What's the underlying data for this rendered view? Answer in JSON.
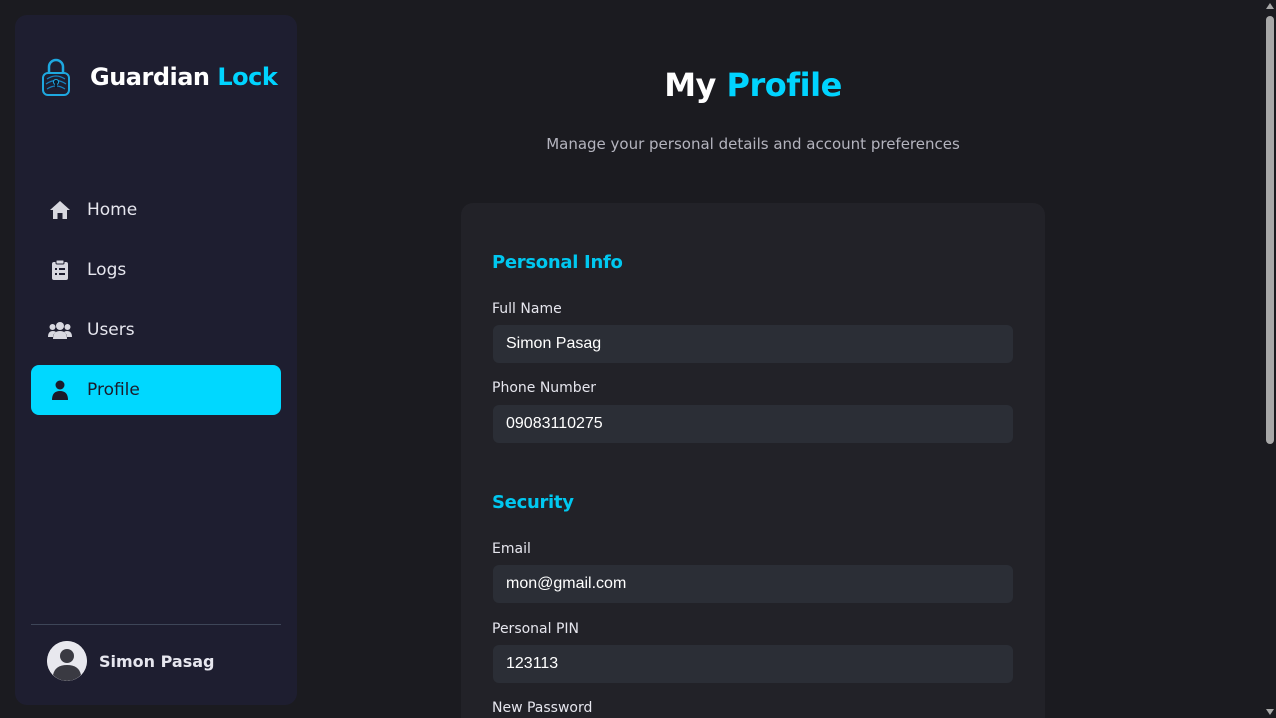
{
  "brand": {
    "name_part1": "Guardian",
    "name_part2": "Lock",
    "logo_icon": "padlock-fingerprint-icon"
  },
  "nav": {
    "items": [
      {
        "label": "Home",
        "icon": "home-icon",
        "active": false
      },
      {
        "label": "Logs",
        "icon": "clipboard-list-icon",
        "active": false
      },
      {
        "label": "Users",
        "icon": "users-icon",
        "active": false
      },
      {
        "label": "Profile",
        "icon": "user-icon",
        "active": true
      }
    ]
  },
  "user": {
    "name": "Simon Pasag",
    "avatar_icon": "user-avatar-icon"
  },
  "page": {
    "title_part1": "My",
    "title_part2": "Profile",
    "subtitle": "Manage your personal details and account preferences"
  },
  "personal_info": {
    "title": "Personal Info",
    "full_name_label": "Full Name",
    "full_name_value": "Simon Pasag",
    "phone_label": "Phone Number",
    "phone_value": "09083110275"
  },
  "security": {
    "title": "Security",
    "email_label": "Email",
    "email_value": "mon@gmail.com",
    "pin_label": "Personal PIN",
    "pin_value": "123113",
    "new_password_label": "New Password"
  },
  "colors": {
    "accent": "#00d4ff",
    "background": "#1b1b20",
    "sidebar": "#1e1e30",
    "card": "#222228",
    "input": "#2b2e36"
  }
}
